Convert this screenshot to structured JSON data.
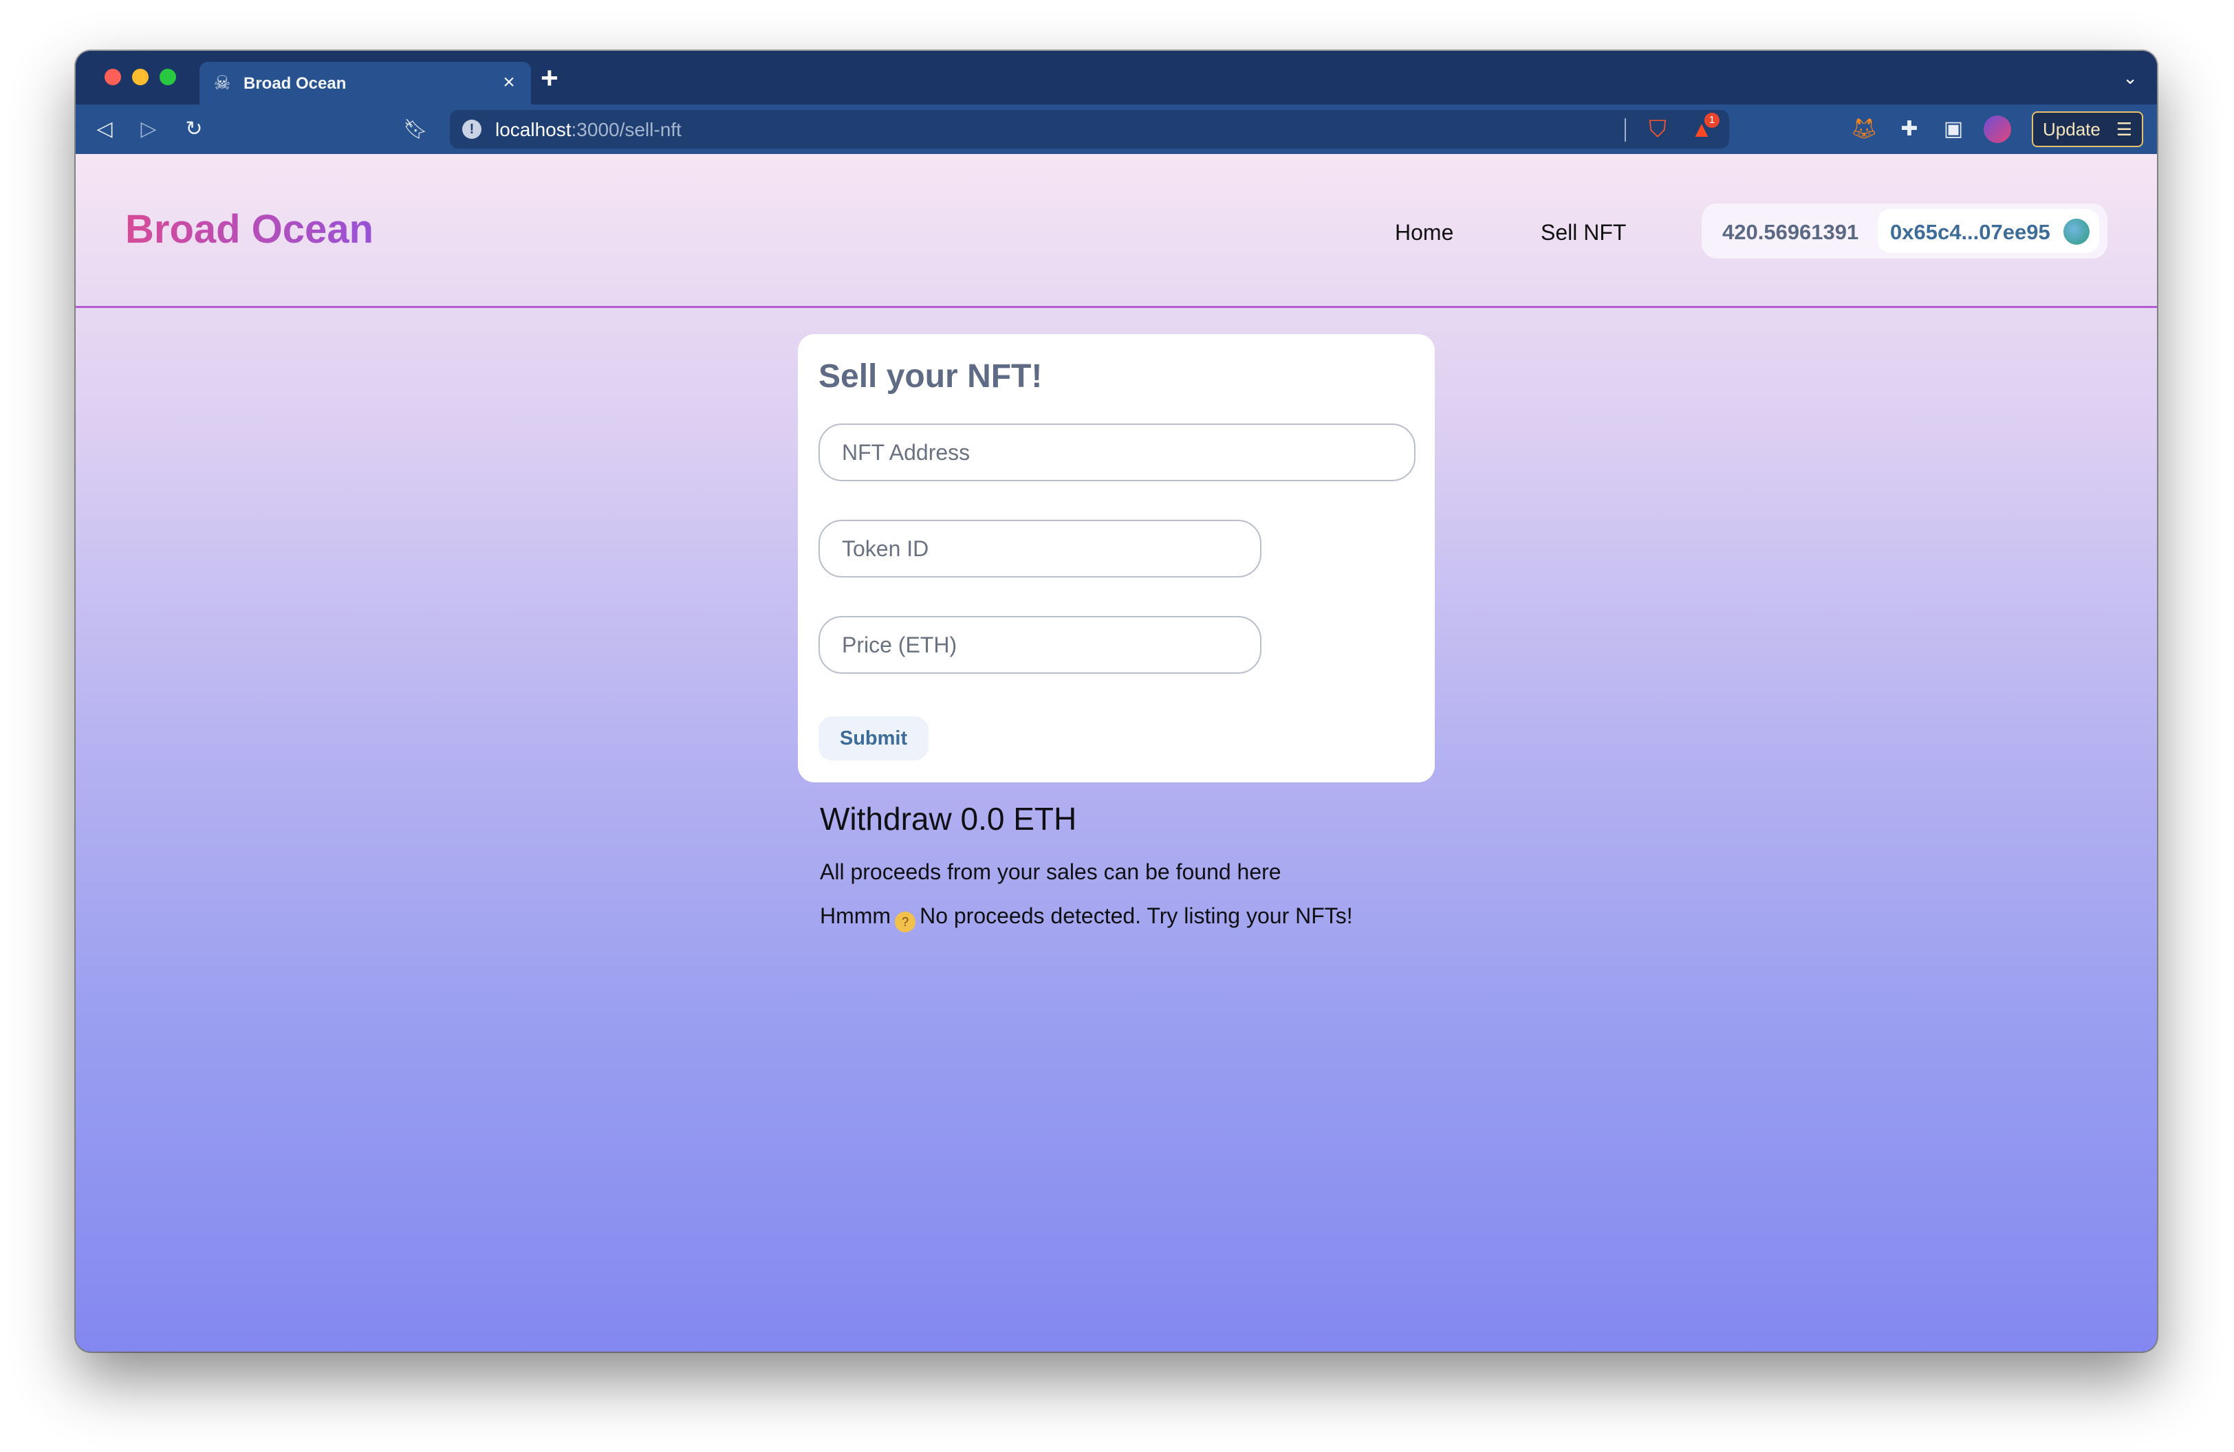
{
  "browser": {
    "tab": {
      "title": "Broad Ocean",
      "icon": "skull-crossbones-icon",
      "close": "×"
    },
    "new_tab": "+",
    "url": {
      "host": "localhost",
      "path": ":3000/sell-nft"
    },
    "rewards_badge": "1",
    "update_label": "Update"
  },
  "header": {
    "brand": "Broad Ocean",
    "nav": {
      "home": "Home",
      "sell": "Sell NFT"
    },
    "wallet": {
      "balance": "420.56961391",
      "address": "0x65c4...07ee95"
    }
  },
  "form": {
    "title": "Sell your NFT!",
    "nft_address_placeholder": "NFT Address",
    "token_id_placeholder": "Token ID",
    "price_placeholder": "Price (ETH)",
    "submit_label": "Submit"
  },
  "withdraw": {
    "title": "Withdraw 0.0 ETH",
    "subtitle": "All proceeds from your sales can be found here",
    "empty_prefix": "Hmmm",
    "empty_text": "No proceeds detected. Try listing your NFTs!"
  },
  "colors": {
    "browser_chrome": "#1b3566",
    "toolbar": "#27518f",
    "brand_gradient_start": "#d64b98",
    "brand_gradient_end": "#9852d6",
    "accent_text": "#3d6c98",
    "page_bg_top": "#f6e5f3",
    "page_bg_bottom": "#8388f0"
  }
}
